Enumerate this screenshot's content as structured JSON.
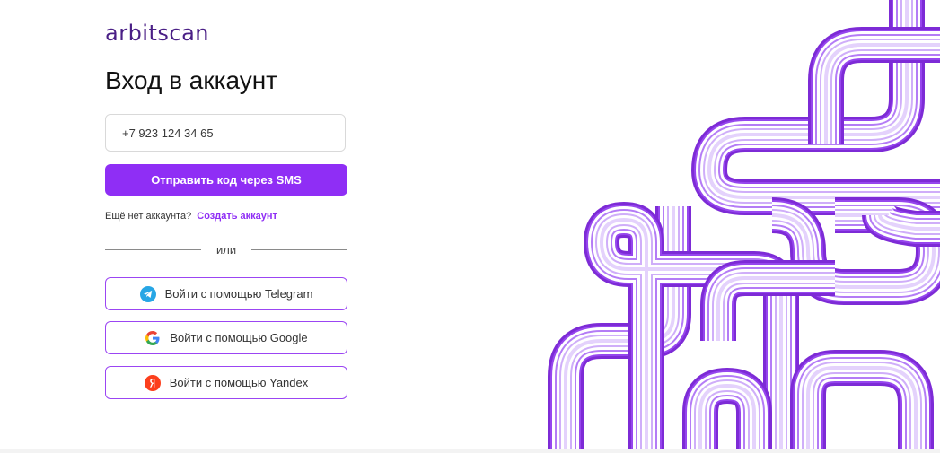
{
  "brand": {
    "logo_text": "arbitscan"
  },
  "login": {
    "title": "Вход в аккаунт",
    "phone_placeholder": "+7 923 124 34 65",
    "sms_button": "Отправить код через SMS",
    "no_account_text": "Ещё нет аккаунта?",
    "create_account_link": "Создать аккаунт",
    "divider_text": "или"
  },
  "oauth": [
    {
      "label": "Войти с помощью Telegram",
      "icon": "telegram-icon"
    },
    {
      "label": "Войти с помощью Google",
      "icon": "google-icon"
    },
    {
      "label": "Войти с помощью Yandex",
      "icon": "yandex-icon"
    }
  ],
  "colors": {
    "accent": "#8f2ef5",
    "logo": "#4a1f86",
    "telegram": "#27a6e5",
    "yandex": "#fc3f1d"
  }
}
